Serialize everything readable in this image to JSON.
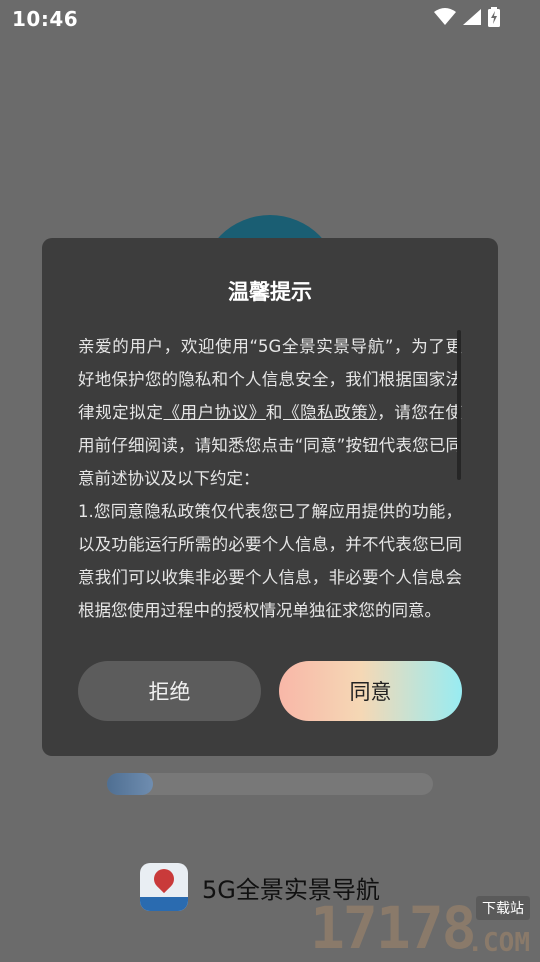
{
  "status_bar": {
    "time": "10:46"
  },
  "dialog": {
    "title": "温馨提示",
    "body": {
      "p1_start": "亲爱的用户，欢迎使用“5G全景实景导航”，为了更好地保护您的隐私和个人信息安全，我们根据国家法律规定拟定",
      "link_user_agreement": "《用户协议》",
      "and": "和",
      "link_privacy_policy": "《隐私政策》",
      "p1_end": "，请您在使用前仔细阅读，请知悉您点击“同意”按钮代表您已同意前述协议及以下约定：",
      "p2": "1.您同意隐私政策仅代表您已了解应用提供的功能，以及功能运行所需的必要个人信息，并不代表您已同意我们可以收集非必要个人信息，非必要个人信息会根据您使用过程中的授权情况单独征求您的同意。"
    },
    "reject_label": "拒绝",
    "agree_label": "同意"
  },
  "background": {
    "app_title": "5G全景实景导航",
    "progress_fraction": 0.14
  },
  "colors": {
    "dialog_bg": "#3d3d3d",
    "reject_bg": "#5c5c5c",
    "agree_gradient_start": "#f8b7a8",
    "agree_gradient_end": "#98ecf2"
  }
}
